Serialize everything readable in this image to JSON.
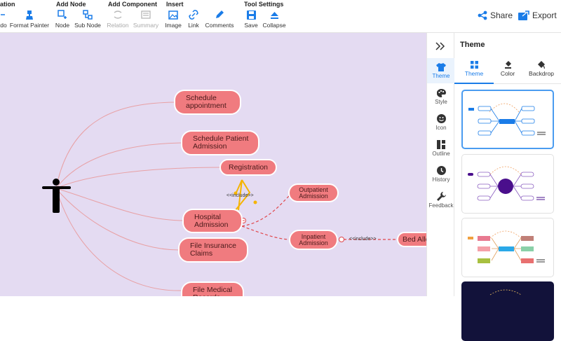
{
  "toolbar": {
    "groups": {
      "relation": "ation",
      "add_node": "Add Node",
      "add_component": "Add Component",
      "insert": "Insert",
      "tool_settings": "Tool Settings"
    },
    "buttons": {
      "redo": "do",
      "format_painter": "Format Painter",
      "node": "Node",
      "sub_node": "Sub Node",
      "relation": "Relation",
      "summary": "Summary",
      "image": "Image",
      "link": "Link",
      "comments": "Comments",
      "save": "Save",
      "collapse": "Collapse"
    },
    "share": "Share",
    "export": "Export"
  },
  "canvas": {
    "nodes": {
      "schedule_appointment": "Schedule\nappointment",
      "schedule_patient_admission": "Schedule Patient\nAdmission",
      "registration": "Registration",
      "outpatient_admission": "Outpatient\nAdmission",
      "hospital_admission": "Hospital\nAdmission",
      "inpatient_admission": "Inpatient\nAdmission",
      "bed_allo": "Bed Allo",
      "file_insurance_claims": "File Insurance\nClaims",
      "file_medical": "File Medical\nRecords"
    },
    "include_label_1": "<<include>>",
    "include_label_2": "<<include>>"
  },
  "side_tabs": {
    "theme": "Theme",
    "style": "Style",
    "icon": "Icon",
    "outline": "Outline",
    "history": "History",
    "feedback": "Feedback"
  },
  "panel": {
    "title": "Theme",
    "tabs": {
      "theme": "Theme",
      "color": "Color",
      "backdrop": "Backdrop"
    }
  },
  "colors": {
    "accent": "#1a7ce8",
    "node_fill": "#f07b7f",
    "canvas_bg": "#e4dbf2",
    "link_line": "#e8a0a4",
    "relation_line": "#e0474c",
    "include_line": "#f5b400"
  }
}
